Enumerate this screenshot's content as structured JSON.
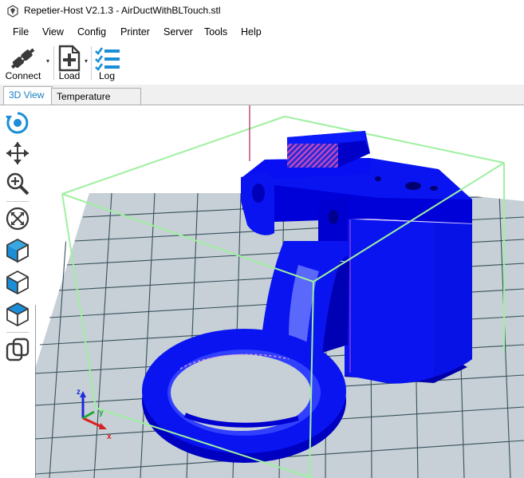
{
  "window": {
    "title": "Repetier-Host V2.1.3 - AirDuctWithBLTouch.stl"
  },
  "menu": {
    "items": [
      "File",
      "View",
      "Config",
      "Printer",
      "Server",
      "Tools",
      "Help"
    ]
  },
  "toolbar": {
    "connect_label": "Connect",
    "load_label": "Load",
    "log_label": "Log"
  },
  "tabs": {
    "items": [
      "3D View",
      "Temperature Curve"
    ],
    "active": "3D View"
  },
  "sidebar": {
    "tools": [
      "rotate-view-icon",
      "move-view-icon",
      "zoom-icon",
      "fit-view-icon",
      "isometric-view-icon",
      "front-view-icon",
      "top-view-icon",
      "parallel-projection-icon"
    ]
  },
  "viewport": {
    "axes": {
      "x": "x",
      "y": "y",
      "z": "z"
    },
    "colors": {
      "model": "#0a14f0",
      "model_shadow": "#0000a8",
      "bed": "#c6d0d6",
      "bed_grid": "#39505c",
      "build_volume": "#9ff0a0"
    }
  }
}
